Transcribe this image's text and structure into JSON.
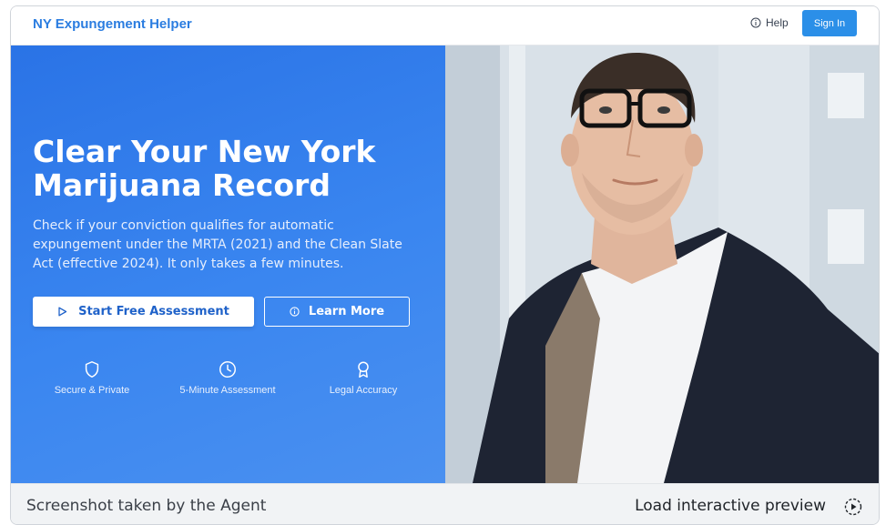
{
  "header": {
    "brand": "NY Expungement Helper",
    "help_label": "Help",
    "signin_label": "Sign In"
  },
  "hero": {
    "title": "Clear Your New York Marijuana Record",
    "description": "Check if your conviction qualifies for automatic expungement under the MRTA (2021) and the Clean Slate Act (effective 2024). It only takes a few minutes.",
    "primary_button": "Start Free Assessment",
    "secondary_button": "Learn More",
    "features": [
      {
        "label": "Secure & Private",
        "icon": "shield-icon"
      },
      {
        "label": "5-Minute Assessment",
        "icon": "clock-icon"
      },
      {
        "label": "Legal Accuracy",
        "icon": "award-icon"
      }
    ],
    "photo_icon": "person-photo"
  },
  "agent_bar": {
    "left_text": "Screenshot taken by the Agent",
    "right_text": "Load interactive preview",
    "icon": "play-circle-icon"
  },
  "colors": {
    "brand": "#2b7de0",
    "hero_blue": "#2a73e6",
    "signin": "#2b8fe8"
  }
}
